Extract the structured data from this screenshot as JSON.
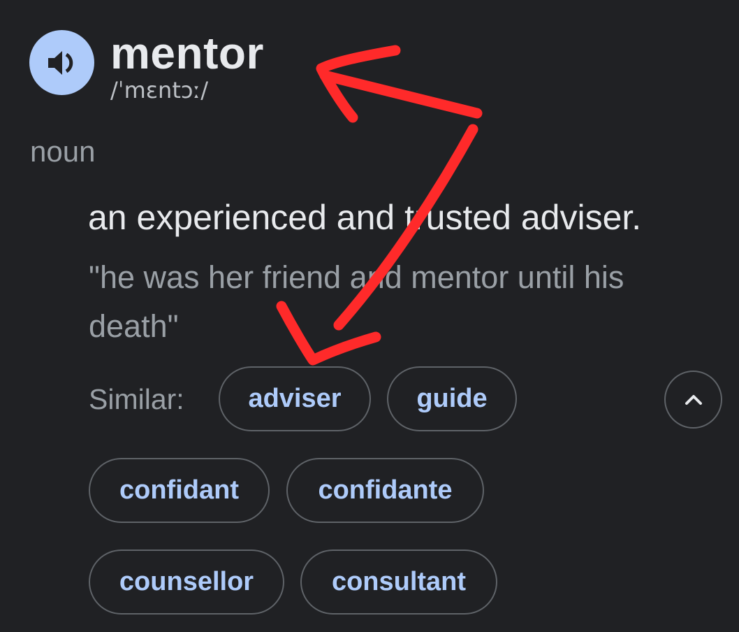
{
  "entry": {
    "word": "mentor",
    "phonetic": "/ˈmɛntɔː/",
    "part_of_speech": "noun",
    "definition": "an experienced and trusted adviser.",
    "example": "\"he was her friend and mentor until his death\""
  },
  "similar": {
    "label": "Similar:",
    "chips": [
      "adviser",
      "guide",
      "confidant",
      "confidante",
      "counsellor",
      "consultant"
    ]
  },
  "icons": {
    "speaker": "speaker-icon",
    "collapse": "chevron-up-icon"
  },
  "colors": {
    "background": "#202124",
    "accent": "#aecbfa",
    "annotation": "#ff2a2a"
  }
}
